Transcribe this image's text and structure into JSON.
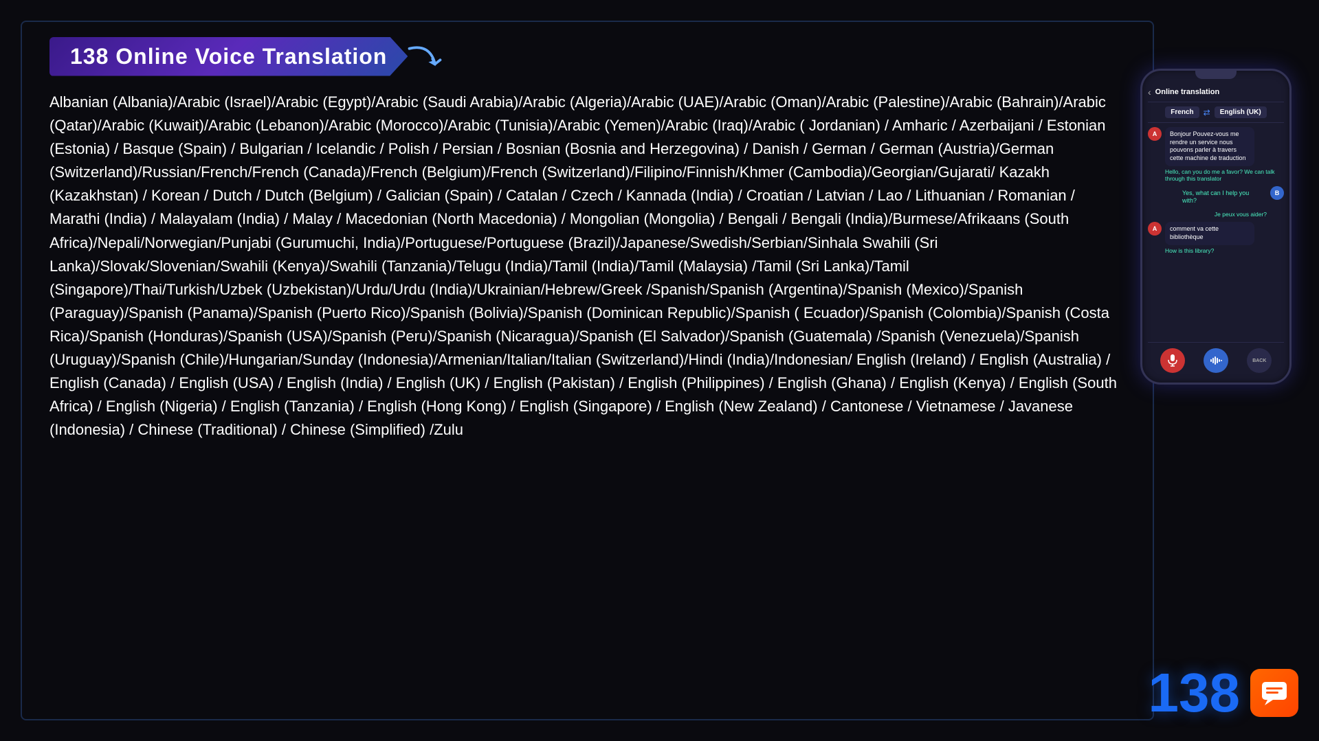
{
  "title": "138 Online Voice Translation",
  "languages": "Albanian (Albania)/Arabic (Israel)/Arabic (Egypt)/Arabic (Saudi Arabia)/Arabic (Algeria)/Arabic (UAE)/Arabic (Oman)/Arabic (Palestine)/Arabic (Bahrain)/Arabic (Qatar)/Arabic (Kuwait)/Arabic (Lebanon)/Arabic (Morocco)/Arabic (Tunisia)/Arabic (Yemen)/Arabic (Iraq)/Arabic ( Jordanian) / Amharic / Azerbaijani / Estonian (Estonia) / Basque (Spain) / Bulgarian / Icelandic / Polish / Persian / Bosnian (Bosnia and Herzegovina) / Danish / German / German (Austria)/German (Switzerland)/Russian/French/French (Canada)/French (Belgium)/French (Switzerland)/Filipino/Finnish/Khmer (Cambodia)/Georgian/Gujarati/ Kazakh (Kazakhstan) / Korean / Dutch / Dutch (Belgium) / Galician (Spain) / Catalan / Czech / Kannada (India) / Croatian / Latvian / Lao / Lithuanian / Romanian / Marathi (India) / Malayalam (India) / Malay / Macedonian (North Macedonia) / Mongolian (Mongolia) / Bengali / Bengali (India)/Burmese/Afrikaans (South Africa)/Nepali/Norwegian/Punjabi (Gurumuchi, India)/Portuguese/Portuguese (Brazil)/Japanese/Swedish/Serbian/Sinhala Swahili (Sri Lanka)/Slovak/Slovenian/Swahili (Kenya)/Swahili (Tanzania)/Telugu (India)/Tamil (India)/Tamil (Malaysia) /Tamil (Sri Lanka)/Tamil (Singapore)/Thai/Turkish/Uzbek (Uzbekistan)/Urdu/Urdu (India)/Ukrainian/Hebrew/Greek /Spanish/Spanish (Argentina)/Spanish (Mexico)/Spanish (Paraguay)/Spanish (Panama)/Spanish (Puerto Rico)/Spanish (Bolivia)/Spanish (Dominican Republic)/Spanish ( Ecuador)/Spanish (Colombia)/Spanish (Costa Rica)/Spanish (Honduras)/Spanish (USA)/Spanish (Peru)/Spanish (Nicaragua)/Spanish (El Salvador)/Spanish (Guatemala) /Spanish (Venezuela)/Spanish (Uruguay)/Spanish (Chile)/Hungarian/Sunday (Indonesia)/Armenian/Italian/Italian (Switzerland)/Hindi (India)/Indonesian/ English (Ireland) / English (Australia) / English (Canada) / English (USA) / English (India) / English (UK) / English (Pakistan) / English (Philippines) / English (Ghana) / English (Kenya) / English (South Africa) / English (Nigeria) / English (Tanzania) / English (Hong Kong) / English (Singapore) / English (New Zealand) / Cantonese / Vietnamese / Javanese (Indonesia) / Chinese (Traditional) / Chinese (Simplified) /Zulu",
  "phone": {
    "title": "Online translation",
    "lang_from": "French",
    "lang_to": "English (UK)",
    "messages": [
      {
        "side": "left",
        "avatar": "A",
        "bubble_text": "Bonjour Pouvez-vous me rendre un service nous pouvons parler à travers cette machine de traduction",
        "translated": "Hello, can you do me a favor? We can talk through this translator"
      },
      {
        "side": "right",
        "avatar": "B",
        "bubble_text": "Yes, what can I help you with?",
        "translated": "Je peux vous aider?"
      },
      {
        "side": "left",
        "avatar": "A",
        "bubble_text": "comment va cette bibliothèque",
        "translated": "How is this library?"
      }
    ],
    "controls": [
      "mic-icon",
      "wave-icon",
      "back-label"
    ]
  },
  "badge": {
    "number": "138",
    "icon": "💬"
  }
}
